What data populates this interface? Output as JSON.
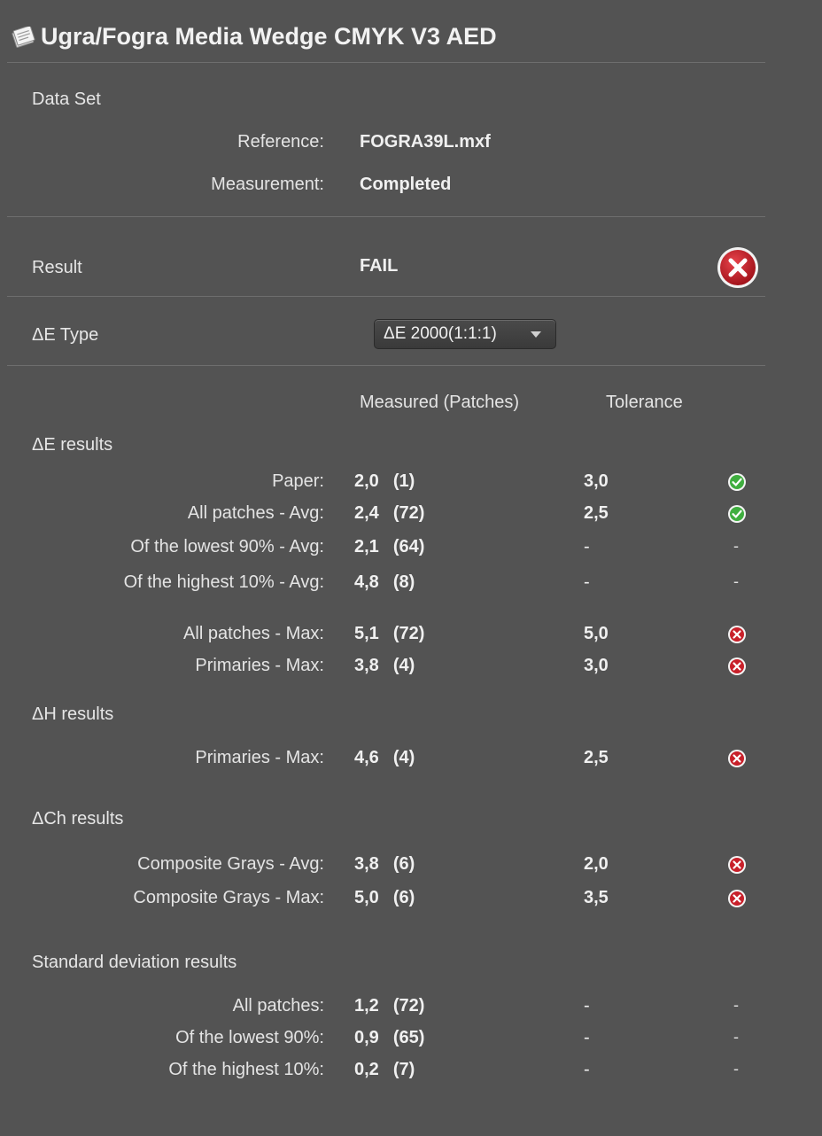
{
  "window": {
    "title": "Ugra/Fogra Media Wedge CMYK V3 AED",
    "title_icon": "document-icon"
  },
  "data_set": {
    "heading": "Data Set",
    "reference_label": "Reference:",
    "reference_value": "FOGRA39L.mxf",
    "measurement_label": "Measurement:",
    "measurement_value": "Completed"
  },
  "result": {
    "label": "Result",
    "value": "FAIL",
    "status_icon": "fail-icon"
  },
  "de_type": {
    "label": "ΔE Type",
    "selected": "ΔE 2000(1:1:1)"
  },
  "columns": {
    "measured": "Measured (Patches)",
    "tolerance": "Tolerance"
  },
  "sections": {
    "de": {
      "heading": "ΔE results",
      "rows": [
        {
          "label": "Paper:",
          "value": "2,0",
          "patches": "(1)",
          "tolerance": "3,0",
          "status": "pass"
        },
        {
          "label": "All patches - Avg:",
          "value": "2,4",
          "patches": "(72)",
          "tolerance": "2,5",
          "status": "pass"
        },
        {
          "label": "Of the lowest 90% - Avg:",
          "value": "2,1",
          "patches": "(64)",
          "tolerance": "-",
          "status": "-"
        },
        {
          "label": "Of the highest 10% - Avg:",
          "value": "4,8",
          "patches": "(8)",
          "tolerance": "-",
          "status": "-"
        },
        {
          "label": "All patches - Max:",
          "value": "5,1",
          "patches": "(72)",
          "tolerance": "5,0",
          "status": "fail"
        },
        {
          "label": "Primaries - Max:",
          "value": "3,8",
          "patches": "(4)",
          "tolerance": "3,0",
          "status": "fail"
        }
      ]
    },
    "dh": {
      "heading": "ΔH results",
      "rows": [
        {
          "label": "Primaries - Max:",
          "value": "4,6",
          "patches": "(4)",
          "tolerance": "2,5",
          "status": "fail"
        }
      ]
    },
    "dch": {
      "heading": "ΔCh results",
      "rows": [
        {
          "label": "Composite Grays - Avg:",
          "value": "3,8",
          "patches": "(6)",
          "tolerance": "2,0",
          "status": "fail"
        },
        {
          "label": "Composite Grays - Max:",
          "value": "5,0",
          "patches": "(6)",
          "tolerance": "3,5",
          "status": "fail"
        }
      ]
    },
    "sd": {
      "heading": "Standard deviation results",
      "rows": [
        {
          "label": "All patches:",
          "value": "1,2",
          "patches": "(72)",
          "tolerance": "-",
          "status": "-"
        },
        {
          "label": "Of the lowest 90%:",
          "value": "0,9",
          "patches": "(65)",
          "tolerance": "-",
          "status": "-"
        },
        {
          "label": "Of the highest 10%:",
          "value": "0,2",
          "patches": "(7)",
          "tolerance": "-",
          "status": "-"
        }
      ]
    }
  },
  "colors": {
    "background": "#535353",
    "pass": "#3fae3f",
    "fail": "#c8202a"
  }
}
